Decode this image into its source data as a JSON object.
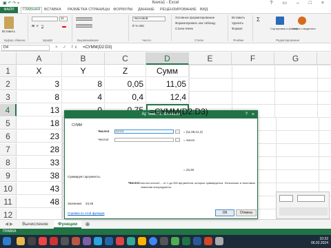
{
  "window": {
    "title": "Книга1 - Excel",
    "qat": "▣ ↶ ↷ ="
  },
  "tabs": [
    "ФАЙЛ",
    "ГЛАВНАЯ",
    "ВСТАВКА",
    "РАЗМЕТКА СТРАНИЦЫ",
    "ФОРМУЛЫ",
    "ДАННЫЕ",
    "РЕЦЕНЗИРОВАНИЕ",
    "ВИД"
  ],
  "ribbon": {
    "paste_label": "Вставить",
    "groups": [
      "Буфер обмена",
      "Шрифт",
      "Выравнивание",
      "Число",
      "Стили",
      "Ячейки",
      "Редактирование"
    ],
    "font_size": "11",
    "number_format": "Числовой",
    "styles": [
      "Условное форматирование",
      "Форматировать как таблицу",
      "Стили ячеек"
    ],
    "cells": [
      "Вставить",
      "Удалить",
      "Формат"
    ],
    "editing": [
      "Σ",
      "Сортировка и фильтр",
      "Найти и выделить"
    ]
  },
  "formula_bar": {
    "name_box": "D4",
    "buttons": "× ✓ fx",
    "formula": "=СУММ(D2:D3)"
  },
  "grid": {
    "columns": [
      "A",
      "B",
      "C",
      "D",
      "E",
      "F",
      "G"
    ],
    "rows": [
      "1",
      "2",
      "3",
      "4",
      "5",
      "6",
      "7",
      "8",
      "9",
      "10",
      "11",
      "12"
    ],
    "cells": [
      [
        "X",
        "Y",
        "Z",
        "Сумм"
      ],
      [
        "3",
        "8",
        "0,05",
        "11,05"
      ],
      [
        "8",
        "4",
        "0,4",
        "12,4"
      ],
      [
        "13",
        "0",
        "0,75",
        "=СУММ(D2:D3)"
      ],
      [
        "18"
      ],
      [
        "23"
      ],
      [
        "28"
      ],
      [
        "33"
      ],
      [
        "38"
      ],
      [
        "43"
      ],
      [
        "48"
      ],
      [
        ""
      ]
    ]
  },
  "sheets": [
    "Вычисление",
    "Функции"
  ],
  "status": {
    "mode": "ПРАВКА"
  },
  "dialog": {
    "title": "Аргументы функции",
    "function_name": "СУММ",
    "arg1_label": "Число1",
    "arg1_value": "D2:D3",
    "arg1_result": "= {11,05;12,4}",
    "arg2_label": "Число2",
    "arg2_result": "= число",
    "total": "= 23,45",
    "description": "Суммирует аргументы.",
    "arg_help_label": "Число1:",
    "arg_help_text": "число1;число2;... от 1 до 255 аргументов, которые суммируются. Логические и текстовые значения игнорируются.",
    "value_label": "Значение:",
    "value": "23,45",
    "help_link": "Справка по этой функции",
    "ok": "ОК",
    "cancel": "Отмена",
    "help_icon": "?",
    "close_icon": "×"
  },
  "taskbar": {
    "time": "10:32",
    "date": "06.02.2024"
  },
  "colors": {
    "accent": "#217346",
    "taskbar": "#1c2a3a"
  }
}
